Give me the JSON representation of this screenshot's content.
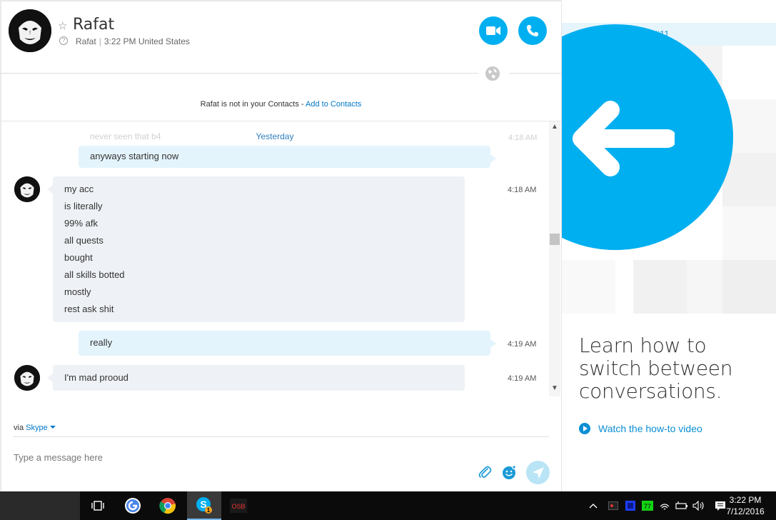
{
  "header": {
    "contact_name": "Rafat",
    "contact_handle": "Rafat",
    "contact_local_time": "3:22 PM United States"
  },
  "notice": {
    "text": "Rafat is not in your Contacts - ",
    "link": "Add to Contacts"
  },
  "messages": {
    "faded_text": "never seen that b4",
    "faded_time": "4:18 AM",
    "date_separator": "Yesterday",
    "items": [
      {
        "direction": "out",
        "lines": [
          "anyways starting now"
        ],
        "time": ""
      },
      {
        "direction": "in",
        "lines": [
          "my acc",
          "is literally",
          "99% afk",
          "all quests",
          "bought",
          "all skills botted",
          "mostly",
          "rest ask shit"
        ],
        "time": "4:18 AM"
      },
      {
        "direction": "out",
        "lines": [
          "really"
        ],
        "time": "4:19 AM"
      },
      {
        "direction": "in",
        "lines": [
          "I'm mad prooud"
        ],
        "time": "4:19 AM"
      }
    ]
  },
  "compose": {
    "via_label": "via",
    "via_service": "Skype",
    "placeholder": "Type a message here"
  },
  "right_panel": {
    "essentials_label": "Skype essentials: #11",
    "title": "Learn how to switch between conversations.",
    "watch_link": "Watch the how-to video"
  },
  "taskbar": {
    "apps": [
      "task-view",
      "google",
      "chrome",
      "skype",
      "osb"
    ],
    "skype_badge": "1",
    "osb_label": "OSB",
    "tray_green_label": "77",
    "clock_time": "3:22 PM",
    "clock_date": "7/12/2016"
  },
  "colors": {
    "accent": "#00aff0",
    "link": "#0078c8",
    "outgoing_bubble": "#e4f4fc",
    "incoming_bubble": "#eef1f5"
  }
}
